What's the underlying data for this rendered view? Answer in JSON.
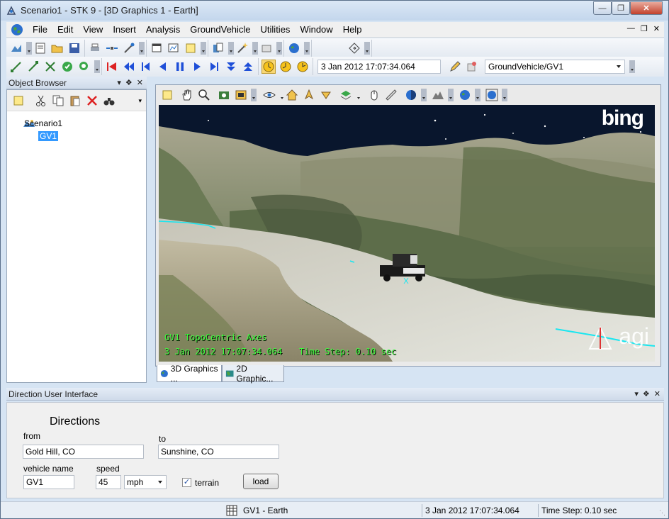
{
  "window": {
    "title": "Scenario1 - STK 9 - [3D Graphics 1 - Earth]"
  },
  "menubar": {
    "items": [
      "File",
      "Edit",
      "View",
      "Insert",
      "Analysis",
      "GroundVehicle",
      "Utilities",
      "Window",
      "Help"
    ]
  },
  "toolbar3": {
    "datetime": "3 Jan 2012 17:07:34.064",
    "object_select": "GroundVehicle/GV1"
  },
  "object_browser": {
    "title": "Object Browser",
    "tree": [
      {
        "label": "Scenario1",
        "icon": "scenario-icon"
      },
      {
        "label": "GV1",
        "icon": "ground-vehicle-icon",
        "selected": true
      }
    ]
  },
  "view3d": {
    "overlay_line1": "GV1 TopoCentric Axes",
    "overlay_datetime": "3 Jan 2012 17:07:34.064",
    "overlay_timestep": "Time Step: 0.10 sec",
    "logo_bing": "bing",
    "logo_agi": "agi",
    "tabs": [
      "3D Graphics ...",
      "2D Graphic..."
    ]
  },
  "directions": {
    "panel_title": "Direction User Interface",
    "heading": "Directions",
    "from_label": "from",
    "from_value": "Gold Hill, CO",
    "to_label": "to",
    "to_value": "Sunshine, CO",
    "vehicle_label": "vehicle name",
    "vehicle_value": "GV1",
    "speed_label": "speed",
    "speed_value": "45",
    "speed_unit": "mph",
    "terrain_label": "terrain",
    "terrain_checked": true,
    "load_label": "load"
  },
  "statusbar": {
    "object": "GV1 - Earth",
    "datetime": "3 Jan 2012 17:07:34.064",
    "timestep": "Time Step: 0.10 sec"
  },
  "colors": {
    "overlay_text": "#3cff3c",
    "selection": "#3399ff",
    "route_line": "#19e6f0"
  }
}
